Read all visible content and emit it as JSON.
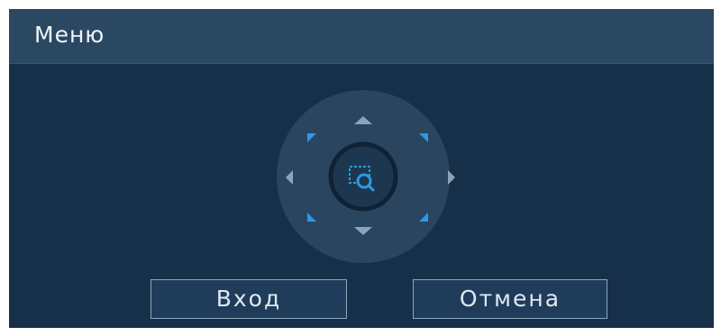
{
  "dialog": {
    "title": "Меню"
  },
  "ptz": {
    "icons": {
      "up": "arrow-up-icon",
      "down": "arrow-down-icon",
      "left": "arrow-left-icon",
      "right": "arrow-right-icon",
      "center": "zoom-magnifier-icon"
    }
  },
  "buttons": {
    "enter_label": "Вход",
    "cancel_label": "Отмена"
  },
  "colors": {
    "background": "#17304a",
    "titlebar": "#2b4863",
    "accent": "#2a9ae0"
  }
}
